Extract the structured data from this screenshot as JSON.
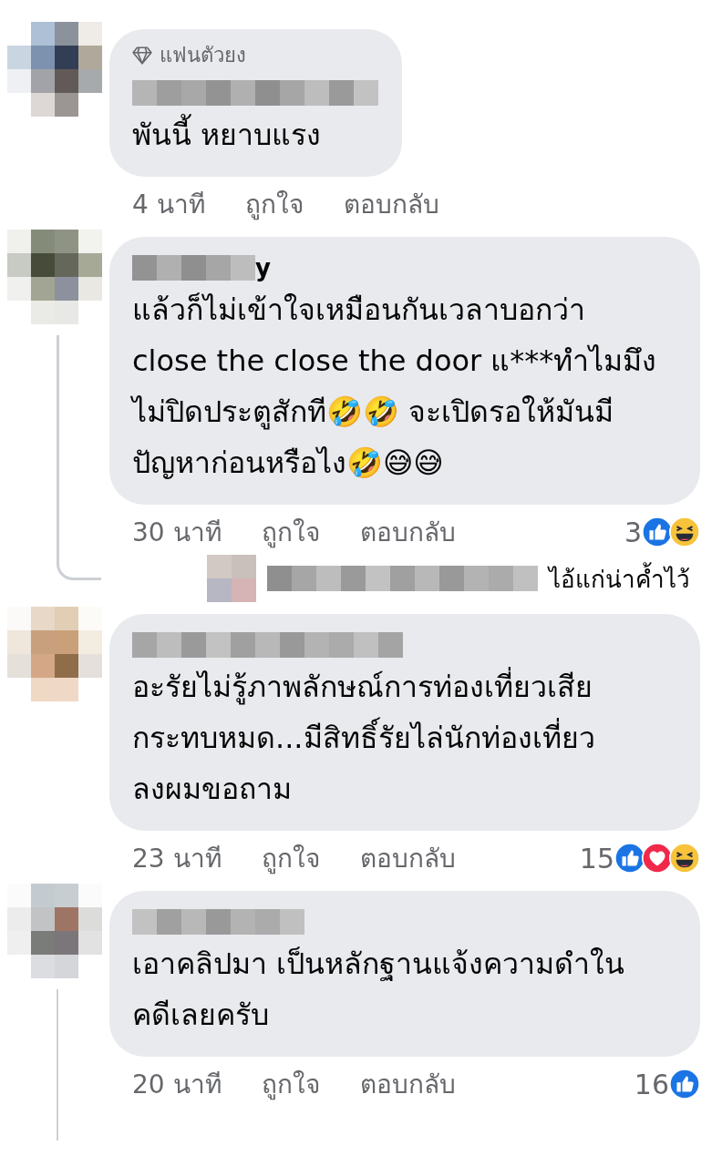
{
  "comments": [
    {
      "badge": "แฟนตัวยง",
      "text_lines": [
        "พันนี้ หยาบแรง"
      ],
      "time": "4 นาที",
      "actions": [
        "ถูกใจ",
        "ตอบกลับ"
      ],
      "thread": false
    },
    {
      "name_visible": "y",
      "text_lines": [
        "แล้วก็ไม่เข้าใจเหมือนกันเวลาบอกว่า",
        "close the close the door แ***ทำไมมึง",
        "ไม่ปิดประตูสักที🤣🤣 จะเปิดรอให้มันมี",
        "ปัญหาก่อนหรือไง🤣😅😅"
      ],
      "time": "30 นาที",
      "actions": [
        "ถูกใจ",
        "ตอบกลับ"
      ],
      "reactions": {
        "count": "3",
        "icons": [
          {
            "kind": "like"
          },
          {
            "kind": "haha"
          }
        ]
      },
      "thread": true,
      "reply_preview": {
        "text": "ไอ้แก่น่าค้ำไว้"
      }
    },
    {
      "text_lines": [
        "อะรัยไม่รู้ภาพลักษณ์การท่องเที่ยวเสีย",
        "กระทบหมด...มีสิทธิ์รัยไล่นักท่องเที่ยว",
        "ลงผมขอถาม"
      ],
      "time": "23 นาที",
      "actions": [
        "ถูกใจ",
        "ตอบกลับ"
      ],
      "reactions": {
        "count": "15",
        "icons": [
          {
            "kind": "like"
          },
          {
            "kind": "love"
          },
          {
            "kind": "haha"
          }
        ]
      },
      "thread": false
    },
    {
      "text_lines": [
        "เอาคลิปมา เป็นหลักฐานแจ้งความดำใน",
        "คดีเลยครับ"
      ],
      "time": "20 นาที",
      "actions": [
        "ถูกใจ",
        "ตอบกลับ"
      ],
      "reactions": {
        "count": "16",
        "icons": [
          {
            "kind": "like"
          }
        ]
      },
      "thread": true
    }
  ]
}
